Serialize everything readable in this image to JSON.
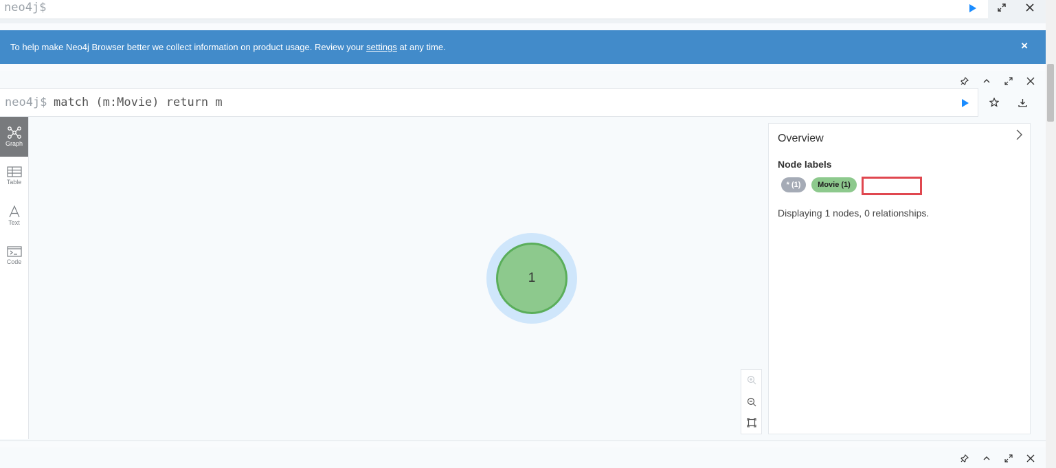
{
  "top_editor": {
    "prompt": "neo4j$"
  },
  "banner": {
    "text_before": "To help make Neo4j Browser better we collect information on product usage. Review your ",
    "link_text": "settings",
    "text_after": " at any time.",
    "close_label": "×"
  },
  "frame": {
    "prompt": "neo4j$",
    "query": "match (m:Movie) return m",
    "sidebar_tabs": [
      {
        "label": "Graph",
        "icon": "graph-icon",
        "active": true
      },
      {
        "label": "Table",
        "icon": "table-icon",
        "active": false
      },
      {
        "label": "Text",
        "icon": "text-icon",
        "active": false
      },
      {
        "label": "Code",
        "icon": "code-icon",
        "active": false
      }
    ],
    "node": {
      "caption": "1",
      "color": "#8dc98d",
      "border_color": "#5aae5a"
    },
    "overview": {
      "title": "Overview",
      "node_labels_title": "Node labels",
      "labels": [
        {
          "text": "* (1)",
          "color": "#a5abb6"
        },
        {
          "text": "Movie (1)",
          "color": "#8dc98d"
        }
      ],
      "summary": "Displaying 1 nodes, 0 relationships."
    }
  },
  "colors": {
    "banner": "#428bca",
    "run_button": "#1a8cff",
    "highlight": "#e0474f"
  }
}
